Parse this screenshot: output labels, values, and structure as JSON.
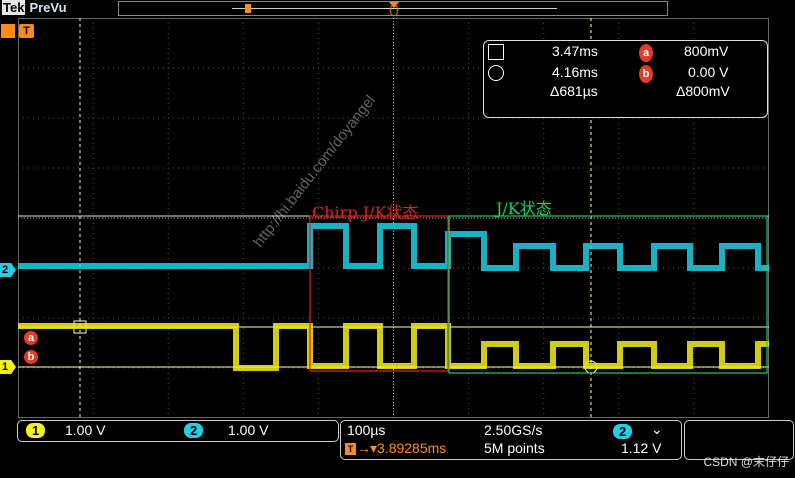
{
  "header": {
    "brand": "Tek",
    "mode": "PreVu"
  },
  "cursor_readout": {
    "cursor1_time": "3.47ms",
    "cursor2_time": "4.16ms",
    "delta_time": "Δ681µs",
    "cursor_a_value": "800mV",
    "cursor_b_value": "0.00 V",
    "delta_value": "Δ800mV",
    "marker_a": "a",
    "marker_b": "b"
  },
  "annotations": {
    "chirp_label": "Chirp J/K状态",
    "jk_label": "J/K状态"
  },
  "left_markers": {
    "trigger": "T",
    "ch2": "2",
    "a": "a",
    "b": "b",
    "ch1": "1"
  },
  "bottom_bar": {
    "ch1_num": "1",
    "ch1_scale": "1.00 V",
    "ch2_num": "2",
    "ch2_scale": "1.00 V",
    "timebase": "100µs",
    "sample_rate": "2.50GS/s",
    "trigger_position": "▾3.89285ms",
    "record_length": "5M points",
    "trigger_source": "2",
    "trigger_slope": "⌄",
    "trigger_level": "1.12 V"
  },
  "watermark": {
    "text": "CSDN @末仔仔",
    "overlay": "http://hi.baidu.com/doyangel"
  },
  "colors": {
    "ch1": "#f4f019",
    "ch2": "#20d0e6",
    "red_box": "#e61e1e",
    "green_box": "#19d25b",
    "grid": "#555555"
  }
}
